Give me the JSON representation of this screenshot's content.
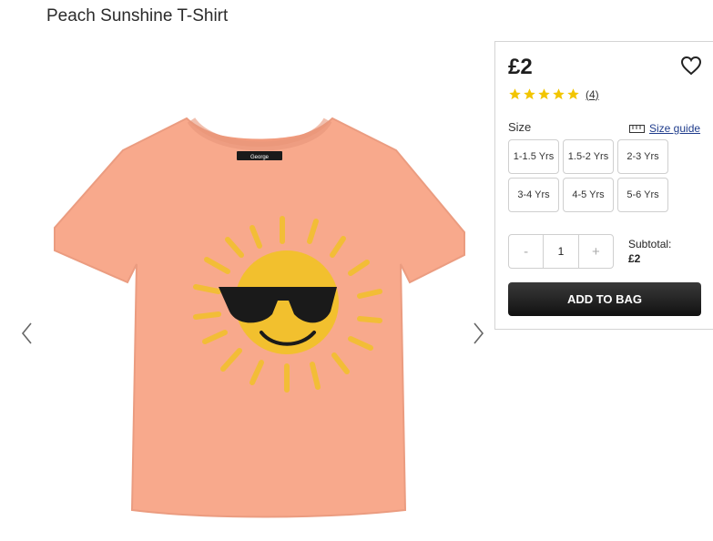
{
  "product": {
    "title": "Peach Sunshine T-Shirt",
    "price": "£2",
    "rating": 5,
    "review_count": "(4)",
    "shirt_label": "George"
  },
  "size_selector": {
    "label": "Size",
    "guide_label": "Size guide",
    "options": [
      "1-1.5 Yrs",
      "1.5-2 Yrs",
      "2-3 Yrs",
      "3-4 Yrs",
      "4-5 Yrs",
      "5-6 Yrs"
    ]
  },
  "quantity": {
    "minus": "-",
    "value": "1",
    "plus": "+"
  },
  "subtotal": {
    "label": "Subtotal:",
    "amount": "£2"
  },
  "actions": {
    "add_to_bag": "ADD TO BAG"
  },
  "icons": {
    "wishlist": "heart-icon",
    "prev": "chevron-left-icon",
    "next": "chevron-right-icon",
    "size_guide": "ruler-icon",
    "star": "star-icon"
  },
  "colors": {
    "shirt": "#f8a98c",
    "sun": "#f2c02e",
    "star": "#f2c500",
    "button_dark": "#1a1a1a",
    "link": "#1f3c8c"
  }
}
